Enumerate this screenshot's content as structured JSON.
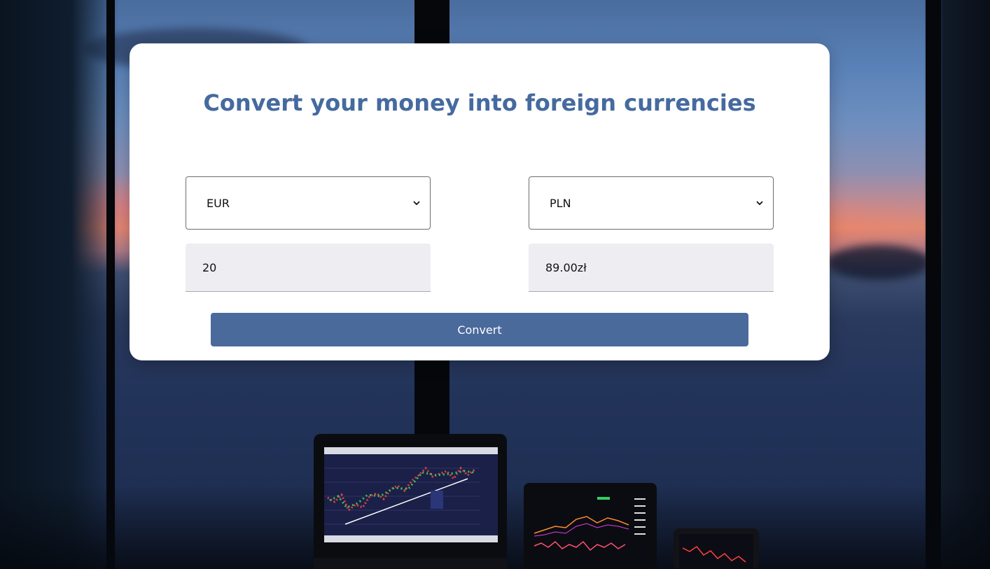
{
  "converter": {
    "title": "Convert your money into foreign currencies",
    "from_currency": "EUR",
    "to_currency": "PLN",
    "amount": "20",
    "result": "89.00zł",
    "convert_label": "Convert"
  },
  "icons": {
    "select_arrow": "chevron-down-icon"
  },
  "colors": {
    "title": "#456a9f",
    "button": "#4a6a9c",
    "card": "#ffffff",
    "input_bg": "#eeeef2"
  }
}
